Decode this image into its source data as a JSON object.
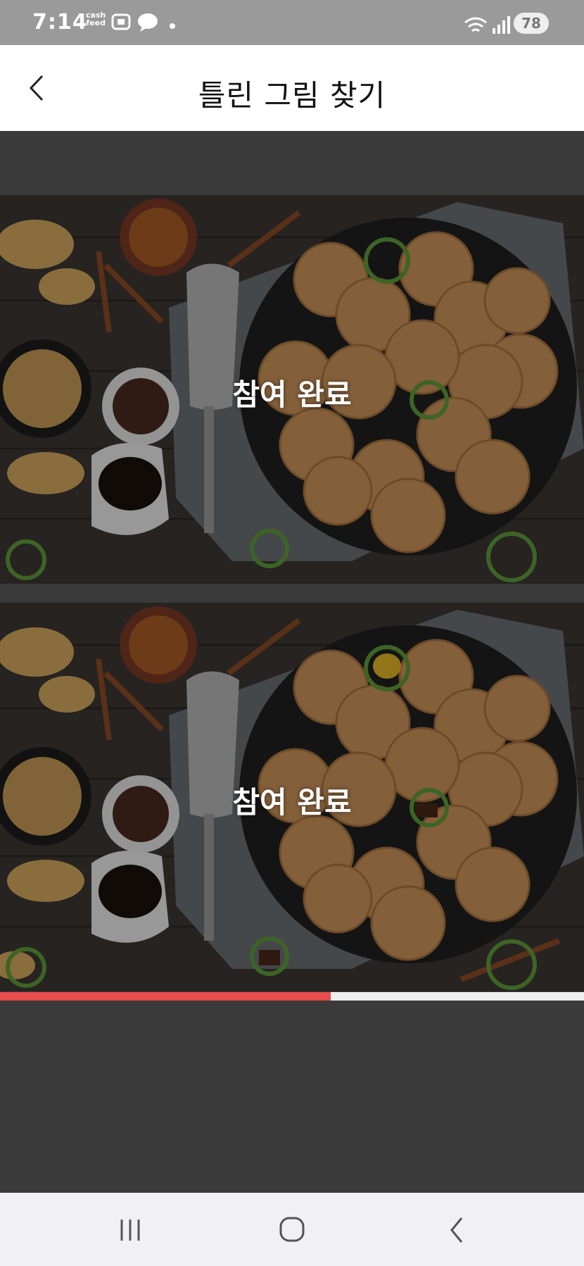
{
  "status_bar": {
    "time": "7:14",
    "cashfeed_line1": "cash",
    "cashfeed_line2": "feed",
    "battery": "78",
    "icons": [
      "gallery-icon",
      "chat-bubble-icon",
      "dot-icon",
      "wifi-icon",
      "signal-icon"
    ]
  },
  "header": {
    "title": "틀린 그림 찾기",
    "back_icon": "chevron-left-icon"
  },
  "game": {
    "panels": [
      {
        "status_text": "참여 완료"
      },
      {
        "status_text": "참여 완료"
      }
    ],
    "found_marker_color": "#5f9a3a",
    "progress_percent": 56.6,
    "progress_color": "#e84b4b"
  },
  "nav_bar": {
    "buttons": [
      "recent-apps-icon",
      "home-icon",
      "back-icon"
    ]
  }
}
